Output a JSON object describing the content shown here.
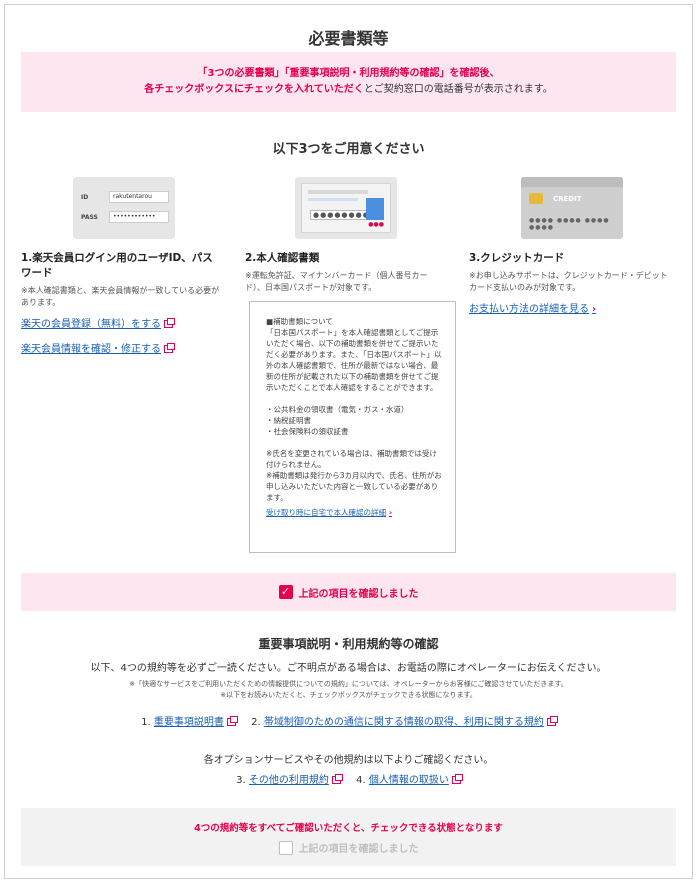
{
  "title": "必要書類等",
  "notice": {
    "line1": "「3つの必要書類」「重要事項説明・利用規約等の確認」を確認後、",
    "line2_highlight": "各チェックボックスにチェックを入れていただく",
    "line2_rest": "とご契約窓口の電話番号が表示されます。"
  },
  "prepare_title": "以下3つをご用意ください",
  "login_illus": {
    "id_label": "ID",
    "id_value": "rakutentarou",
    "pass_label": "PASS",
    "pass_value": "••••••••••••"
  },
  "id_card_illus": {
    "dots": "●●●●●●●●",
    "red_dots": "●●●"
  },
  "credit_illus": {
    "label": "CREDIT",
    "number": "●●●● ●●●● ●●●● ●●●●"
  },
  "col1": {
    "heading": "1.楽天会員ログイン用のユーザID、パスワード",
    "note": "※本人確認書類と、楽天会員情報が一致している必要があります。",
    "link1": "楽天の会員登録（無料）をする",
    "link2": "楽天会員情報を確認・修正する"
  },
  "col2": {
    "heading": "2.本人確認書類",
    "note": "※運転免許証、マイナンバーカード（個人番号カード）、日本国パスポートが対象です。"
  },
  "col3": {
    "heading": "3.クレジットカード",
    "note": "※お申し込みサポートは、クレジットカード・デビットカード支払いのみが対象です。",
    "link": "お支払い方法の詳細を見る"
  },
  "doc_box": {
    "p1": "■補助書類について",
    "p2": "「日本国パスポート」を本人確認書類としてご提示いただく場合、以下の補助書類を併せてご提示いただく必要があります。また、「日本国パスポート」以外の本人確認書類で、住所が最新ではない場合、最新の住所が記載された以下の補助書類を併せてご提示いただくことで本人確認をすることができます。",
    "items": [
      "・公共料金の領収書（電気・ガス・水道）",
      "・納税証明書",
      "・社会保険料の領収証書"
    ],
    "note1": "※氏名を変更されている場合は、補助書類では受け付けられません。",
    "note2": "※補助書類は発行から3カ月以内で、氏名、住所がお申し込みいただいた内容と一致している必要があります。",
    "link": "受け取り時に自宅で本人確認の詳細"
  },
  "check1": {
    "mark": "✓",
    "label": "上記の項目を確認しました"
  },
  "terms": {
    "title": "重要事項説明・利用規約等の確認",
    "lead": "以下、4つの規約等を必ずご一読ください。ご不明点がある場合は、お電話の際にオペレーターにお伝えください。",
    "note1": "※「快適なサービスをご利用いただくための情報提供についての規約」については、オペレーターからお客様にご確認させていただきます。",
    "note2": "※以下をお読みいただくと、チェックボックスがチェックできる状態になります。",
    "items": [
      {
        "num": "1.",
        "label": "重要事項説明書"
      },
      {
        "num": "2.",
        "label": "帯域制御のための通信に関する情報の取得、利用に関する規約"
      },
      {
        "num": "3.",
        "label": "その他の利用規約"
      },
      {
        "num": "4.",
        "label": "個人情報の取扱い"
      }
    ],
    "option_line": "各オプションサービスやその他規約は以下よりご確認ください。"
  },
  "check2": {
    "message": "4つの規約等をすべてご確認いただくと、チェックできる状態となります",
    "label": "上記の項目を確認しました"
  },
  "colors": {
    "accent": "#e5004f",
    "pink_bg": "#fde6ef",
    "link": "#1a5fb4"
  }
}
